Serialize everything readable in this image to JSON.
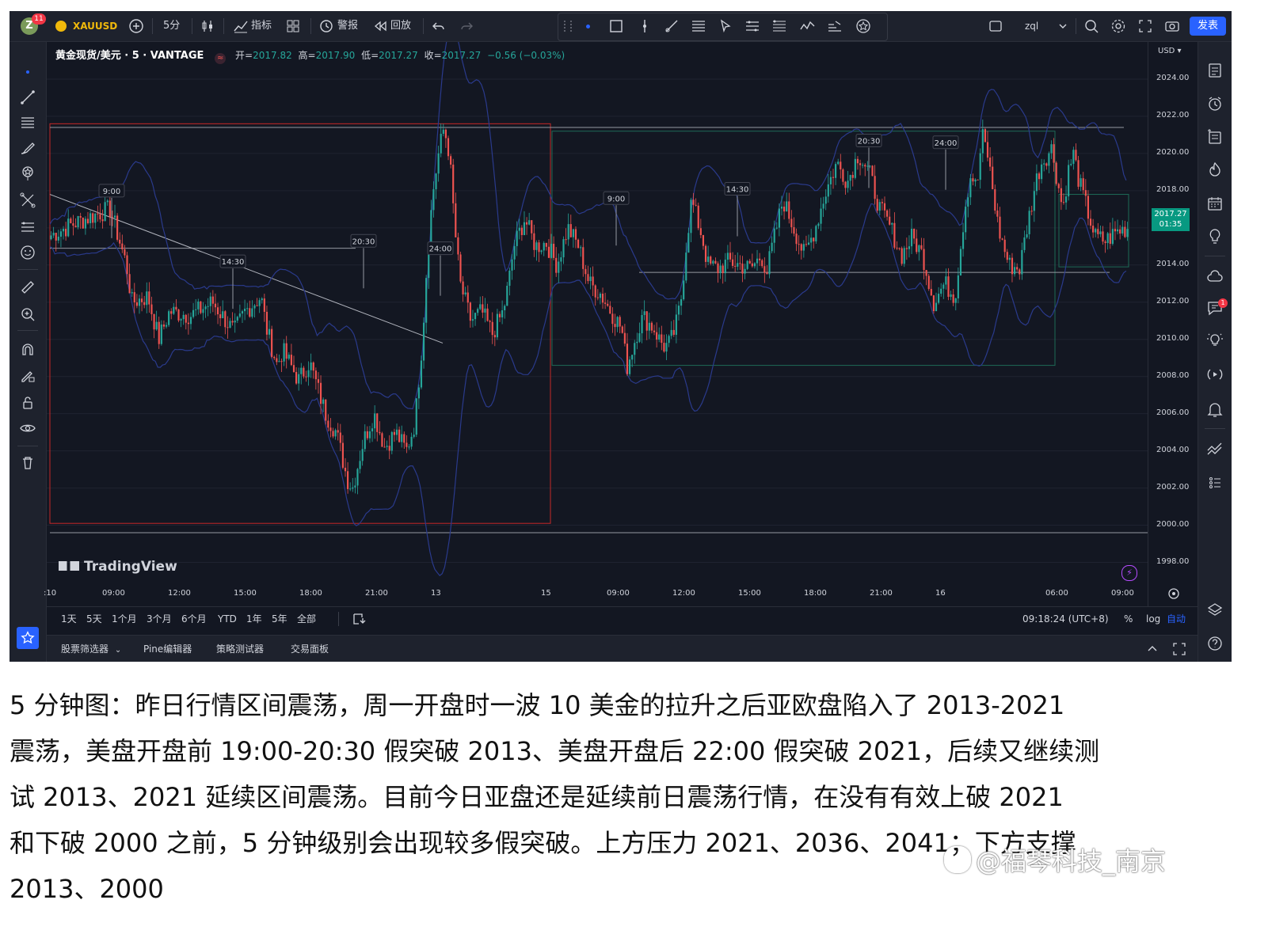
{
  "topbar": {
    "avatar_letter": "Z",
    "notification_count": "11",
    "symbol": "XAUUSD",
    "interval": "5分",
    "indicators_label": "指标",
    "alert_label": "警报",
    "replay_label": "回放",
    "layout_name": "zql",
    "publish_label": "发表"
  },
  "legend": {
    "title": "黄金现货/美元 · 5 · VANTAGE",
    "open_label": "开=",
    "open_value": "2017.82",
    "high_label": "高=",
    "high_value": "2017.90",
    "low_label": "低=",
    "low_value": "2017.27",
    "close_label": "收=",
    "close_value": "2017.27",
    "change": "−0.56 (−0.03%)"
  },
  "price_axis": {
    "currency": "USD",
    "ticks": [
      "2024.00",
      "2022.00",
      "2020.00",
      "2018.00",
      "2016.00",
      "2014.00",
      "2012.00",
      "2010.00",
      "2008.00",
      "2006.00",
      "2004.00",
      "2002.00",
      "2000.00",
      "1998.00"
    ],
    "current_price": "2017.27",
    "countdown": "01:35"
  },
  "time_axis": {
    "ticks": [
      ":10",
      "09:00",
      "12:00",
      "15:00",
      "18:00",
      "21:00",
      "13",
      "15",
      "09:00",
      "12:00",
      "15:00",
      "18:00",
      "21:00",
      "16",
      "06:00",
      "09:00"
    ]
  },
  "chart_data": {
    "type": "candlestick",
    "symbol": "XAUUSD",
    "interval": "5",
    "ylim": [
      1997,
      2026
    ],
    "y_ticks": [
      2024,
      2022,
      2020,
      2018,
      2016,
      2014,
      2012,
      2010,
      2008,
      2006,
      2004,
      2002,
      2000,
      1998
    ],
    "price_path": [
      [
        0,
        2015.6
      ],
      [
        0.02,
        2016.2
      ],
      [
        0.045,
        2016.8
      ],
      [
        0.055,
        2017.0
      ],
      [
        0.07,
        2014.0
      ],
      [
        0.075,
        2012.0
      ],
      [
        0.09,
        2012.3
      ],
      [
        0.1,
        2010.0
      ],
      [
        0.11,
        2011.5
      ],
      [
        0.13,
        2011.3
      ],
      [
        0.15,
        2012.0
      ],
      [
        0.17,
        2010.4
      ],
      [
        0.18,
        2011.5
      ],
      [
        0.195,
        2012.3
      ],
      [
        0.2,
        2010.6
      ],
      [
        0.21,
        2008.6
      ],
      [
        0.215,
        2009.4
      ],
      [
        0.23,
        2007.8
      ],
      [
        0.24,
        2008.8
      ],
      [
        0.255,
        2006.0
      ],
      [
        0.265,
        2005.0
      ],
      [
        0.275,
        2002.5
      ],
      [
        0.28,
        2002.0
      ],
      [
        0.29,
        2004.5
      ],
      [
        0.3,
        2006.0
      ],
      [
        0.31,
        2004.2
      ],
      [
        0.32,
        2005.0
      ],
      [
        0.33,
        2004.0
      ],
      [
        0.338,
        2005.5
      ],
      [
        0.345,
        2010.0
      ],
      [
        0.35,
        2015.0
      ],
      [
        0.355,
        2018.0
      ],
      [
        0.36,
        2020.0
      ],
      [
        0.365,
        2021.4
      ],
      [
        0.37,
        2020.0
      ],
      [
        0.375,
        2016.0
      ],
      [
        0.38,
        2013.0
      ],
      [
        0.39,
        2011.0
      ],
      [
        0.4,
        2011.5
      ],
      [
        0.41,
        2010.3
      ],
      [
        0.42,
        2011.5
      ],
      [
        0.425,
        2013.0
      ],
      [
        0.43,
        2015.0
      ],
      [
        0.44,
        2016.5
      ],
      [
        0.45,
        2015.0
      ],
      [
        0.46,
        2015.2
      ],
      [
        0.47,
        2014.0
      ],
      [
        0.48,
        2016.0
      ],
      [
        0.49,
        2015.0
      ],
      [
        0.5,
        2013.0
      ],
      [
        0.51,
        2012.5
      ],
      [
        0.52,
        2011.5
      ],
      [
        0.53,
        2010.6
      ],
      [
        0.535,
        2008.5
      ],
      [
        0.54,
        2009.5
      ],
      [
        0.545,
        2010.5
      ],
      [
        0.55,
        2011.2
      ],
      [
        0.56,
        2010.6
      ],
      [
        0.565,
        2010.0
      ],
      [
        0.57,
        2009.6
      ],
      [
        0.575,
        2009.8
      ],
      [
        0.58,
        2010.6
      ],
      [
        0.585,
        2012.0
      ],
      [
        0.59,
        2015.0
      ],
      [
        0.595,
        2017.5
      ],
      [
        0.6,
        2016.5
      ],
      [
        0.605,
        2015.5
      ],
      [
        0.61,
        2014.0
      ],
      [
        0.62,
        2013.8
      ],
      [
        0.63,
        2014.2
      ],
      [
        0.64,
        2014.0
      ],
      [
        0.65,
        2013.8
      ],
      [
        0.66,
        2014.5
      ],
      [
        0.665,
        2013.6
      ],
      [
        0.67,
        2015.0
      ],
      [
        0.68,
        2017.5
      ],
      [
        0.69,
        2016.0
      ],
      [
        0.7,
        2014.5
      ],
      [
        0.71,
        2016.0
      ],
      [
        0.72,
        2018.0
      ],
      [
        0.73,
        2019.5
      ],
      [
        0.74,
        2018.5
      ],
      [
        0.75,
        2020.0
      ],
      [
        0.76,
        2019.0
      ],
      [
        0.77,
        2017.0
      ],
      [
        0.78,
        2016.0
      ],
      [
        0.79,
        2014.5
      ],
      [
        0.8,
        2015.5
      ],
      [
        0.81,
        2014.5
      ],
      [
        0.82,
        2012.0
      ],
      [
        0.83,
        2013.0
      ],
      [
        0.84,
        2012.3
      ],
      [
        0.845,
        2015.0
      ],
      [
        0.85,
        2017.5
      ],
      [
        0.855,
        2019.0
      ],
      [
        0.86,
        2018.0
      ],
      [
        0.865,
        2021.0
      ],
      [
        0.87,
        2020.0
      ],
      [
        0.875,
        2018.0
      ],
      [
        0.88,
        2016.0
      ],
      [
        0.89,
        2014.0
      ],
      [
        0.9,
        2013.8
      ],
      [
        0.905,
        2015.5
      ],
      [
        0.91,
        2017.0
      ],
      [
        0.915,
        2018.5
      ],
      [
        0.92,
        2019.5
      ],
      [
        0.93,
        2020.3
      ],
      [
        0.935,
        2018.5
      ],
      [
        0.94,
        2017.0
      ],
      [
        0.945,
        2019.0
      ],
      [
        0.95,
        2020.0
      ],
      [
        0.955,
        2018.5
      ],
      [
        0.96,
        2017.5
      ],
      [
        0.97,
        2015.5
      ],
      [
        0.98,
        2015.3
      ],
      [
        0.99,
        2015.8
      ],
      [
        1.0,
        2016.0
      ]
    ],
    "horizontal_lines": [
      2021.4,
      2013.6,
      1999.6
    ],
    "rectangles": [
      {
        "p_top": 2021.6,
        "p_bottom": 2000.1,
        "color": "#c62828"
      },
      {
        "p_top": 2021.2,
        "p_bottom": 2008.6,
        "color": "#1e6b57"
      },
      {
        "p_top": 2017.8,
        "p_bottom": 2013.9,
        "color": "#1e6b57"
      }
    ],
    "session_labels": [
      "9:00",
      "14:30",
      "20:30",
      "24:00",
      "9:00",
      "14:30",
      "20:30",
      "24:00"
    ]
  },
  "left_toolbar": {
    "tools": [
      "crosshair-icon",
      "trendline-icon",
      "fib-icon",
      "brush-icon",
      "pattern-icon",
      "prediction-icon",
      "text-icon",
      "emoji-icon",
      "ruler-icon",
      "zoom-icon",
      "magnet-icon",
      "lock-draw-icon",
      "lock-icon",
      "eye-icon",
      "trash-icon",
      "favorite-icon"
    ]
  },
  "right_toolbar": {
    "alerts_badge": "1"
  },
  "ranges": {
    "items": [
      "1天",
      "5天",
      "1个月",
      "3个月",
      "6个月",
      "YTD",
      "1年",
      "5年",
      "全部"
    ],
    "clock": "09:18:24 (UTC+8)",
    "percent": "%",
    "log": "log",
    "auto": "自动"
  },
  "bottom_tabs": {
    "items": [
      "股票筛选器",
      "Pine编辑器",
      "策略测试器",
      "交易面板"
    ]
  },
  "branding": {
    "logo_text": "TradingView"
  },
  "caption": {
    "line1": "5 分钟图：昨日行情区间震荡，周一开盘时一波 10 美金的拉升之后亚欧盘陷入了 2013-2021",
    "line2": "震荡，美盘开盘前 19:00-20:30 假突破 2013、美盘开盘后 22:00 假突破 2021，后续又继续测",
    "line3": "试 2013、2021 延续区间震荡。目前今日亚盘还是延续前日震荡行情，在没有有效上破 2021",
    "line4": "和下破 2000 之前，5 分钟级别会出现较多假突破。上方压力 2021、2036、2041；下方支撑",
    "line5": "2013、2000"
  },
  "watermark": {
    "text": "@福琴科技_南京"
  },
  "colors": {
    "background": "#131722",
    "up": "#26a69a",
    "down": "#ef5350",
    "band": "#2a3a8c",
    "accent": "#2962ff"
  }
}
